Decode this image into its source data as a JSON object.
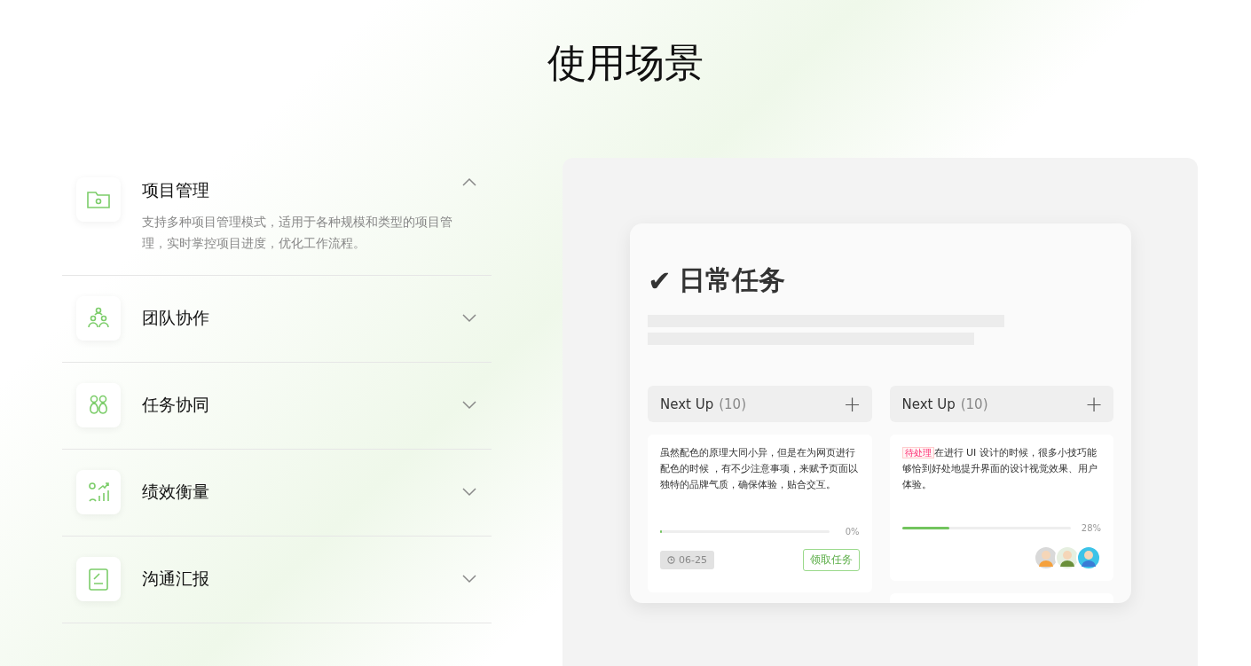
{
  "heading": "使用场景",
  "scenes": [
    {
      "title": "项目管理",
      "expanded": true,
      "description": "支持多种项目管理模式，适用于各种规模和类型的项目管理，实时掌控项目进度，优化工作流程。"
    },
    {
      "title": "团队协作",
      "expanded": false
    },
    {
      "title": "任务协同",
      "expanded": false
    },
    {
      "title": "绩效衡量",
      "expanded": false
    },
    {
      "title": "沟通汇报",
      "expanded": false
    }
  ],
  "preview": {
    "check": "✔",
    "title": "日常任务",
    "columns": [
      {
        "name": "Next Up",
        "count": "(10)",
        "add": "+",
        "cards": [
          {
            "kind": "task",
            "text": "虽然配色的原理大同小异，但是在为网页进行配色的时候 ，有不少注意事项，来赋予页面以独特的品牌气质，确保体验，贴合交互。",
            "level": 0,
            "reading": "0%",
            "date": "06-25",
            "action": "领取任务"
          }
        ]
      },
      {
        "name": "Next Up",
        "count": "(10)",
        "add": "+",
        "cards": [
          {
            "kind": "task",
            "tag": "待处理",
            "text": "在进行 UI 设计的时候，很多小技巧能够恰到好处地提升界面的设计视觉效果、用户体验。",
            "level": 0.28,
            "reading": "28%",
            "avatars": [
              {
                "kind": "light"
              },
              {
                "kind": "beard"
              },
              {
                "kind": "blue"
              }
            ]
          },
          {
            "kind": "stub"
          }
        ]
      }
    ]
  }
}
